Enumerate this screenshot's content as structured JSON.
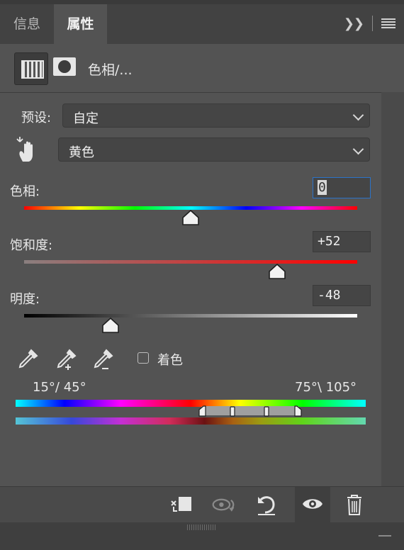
{
  "tabs": [
    {
      "label": "信息",
      "active": false
    },
    {
      "label": "属性",
      "active": true
    }
  ],
  "header": {
    "title": "色相/..."
  },
  "preset": {
    "label": "预设:",
    "value": "自定"
  },
  "channel": {
    "value": "黄色"
  },
  "hue": {
    "label": "色相:",
    "value": "0",
    "slider_fraction": 0.5
  },
  "saturation": {
    "label": "饱和度:",
    "value": "+52",
    "slider_fraction": 0.76
  },
  "lightness": {
    "label": "明度:",
    "value": "-48",
    "slider_fraction": 0.26
  },
  "colorize": {
    "label": "着色",
    "checked": false
  },
  "range": {
    "left": "15°/ 45°",
    "right": "75°\\ 105°"
  },
  "icons": {
    "collapse": "double-chevron-right-icon",
    "menu": "hamburger-menu-icon",
    "adjustment": "hue-saturation-adjustment-icon",
    "mask": "layer-mask-icon",
    "hand": "targeted-adjustment-hand-icon",
    "eyedropper": "eyedropper-icon",
    "eyedropper_add": "eyedropper-add-icon",
    "eyedropper_subtract": "eyedropper-subtract-icon",
    "clip": "clip-to-layer-icon",
    "view_previous": "view-previous-state-icon",
    "reset": "reset-icon",
    "visibility": "eye-icon",
    "delete": "trash-icon"
  },
  "colors": {
    "panel_bg": "#535353",
    "focus_border": "#2b73c9"
  }
}
